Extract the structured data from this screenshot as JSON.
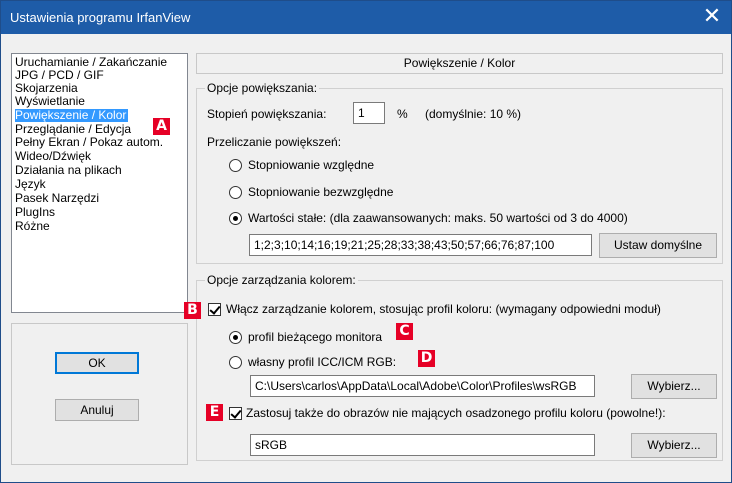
{
  "window": {
    "title": "Ustawienia programu IrfanView",
    "close_symbol": "✕"
  },
  "categories": [
    "Uruchamianie / Zakańczanie",
    "JPG / PCD / GIF",
    "Skojarzenia",
    "Wyświetlanie",
    "Powiększenie / Kolor",
    "Przeglądanie / Edycja",
    "Pełny Ekran / Pokaz autom.",
    "Wideo/Dźwięk",
    "Działania na plikach",
    "Język",
    "Pasek Narzędzi",
    "PlugIns",
    "Różne"
  ],
  "selected_category": "Powiększenie / Kolor",
  "buttons": {
    "ok": "OK",
    "cancel": "Anuluj"
  },
  "panel": {
    "title": "Powiększenie / Kolor",
    "zoom": {
      "group_title": "Opcje powiększania:",
      "step_label": "Stopień powiększania:",
      "step_value": "1",
      "step_unit": "%",
      "step_default": "(domyślnie: 10 %)",
      "recalc_label": "Przeliczanie powiększeń:",
      "option_relative": "Stopniowanie względne",
      "option_absolute": "Stopniowanie bezwzględne",
      "option_fixed": "Wartości stałe: (dla zaawansowanych: maks. 50 wartości od 3 do 4000)",
      "fixed_values": "1;2;3;10;14;16;19;21;25;28;33;38;43;50;57;66;76;87;100",
      "set_defaults_button": "Ustaw domyślne"
    },
    "color": {
      "group_title": "Opcje zarządzania kolorem:",
      "enable_label": "Włącz zarządzanie kolorem, stosując profil koloru: (wymagany odpowiedni moduł)",
      "monitor_profile": "profil bieżącego monitora",
      "own_profile": "własny profil ICC/ICM RGB:",
      "own_profile_path": "C:\\Users\\carlos\\AppData\\Local\\Adobe\\Color\\Profiles\\wsRGB",
      "browse_button": "Wybierz...",
      "apply_label": "Zastosuj także do obrazów nie mających osadzonego profilu koloru (powolne!):",
      "apply_profile": "sRGB",
      "browse_button_2": "Wybierz..."
    }
  },
  "markers": {
    "a": "A",
    "b": "B",
    "c": "C",
    "d": "D",
    "e": "E"
  },
  "colors": {
    "titlebar": "#1e5ca8",
    "selection": "#3399ff",
    "marker": "#e60026"
  }
}
